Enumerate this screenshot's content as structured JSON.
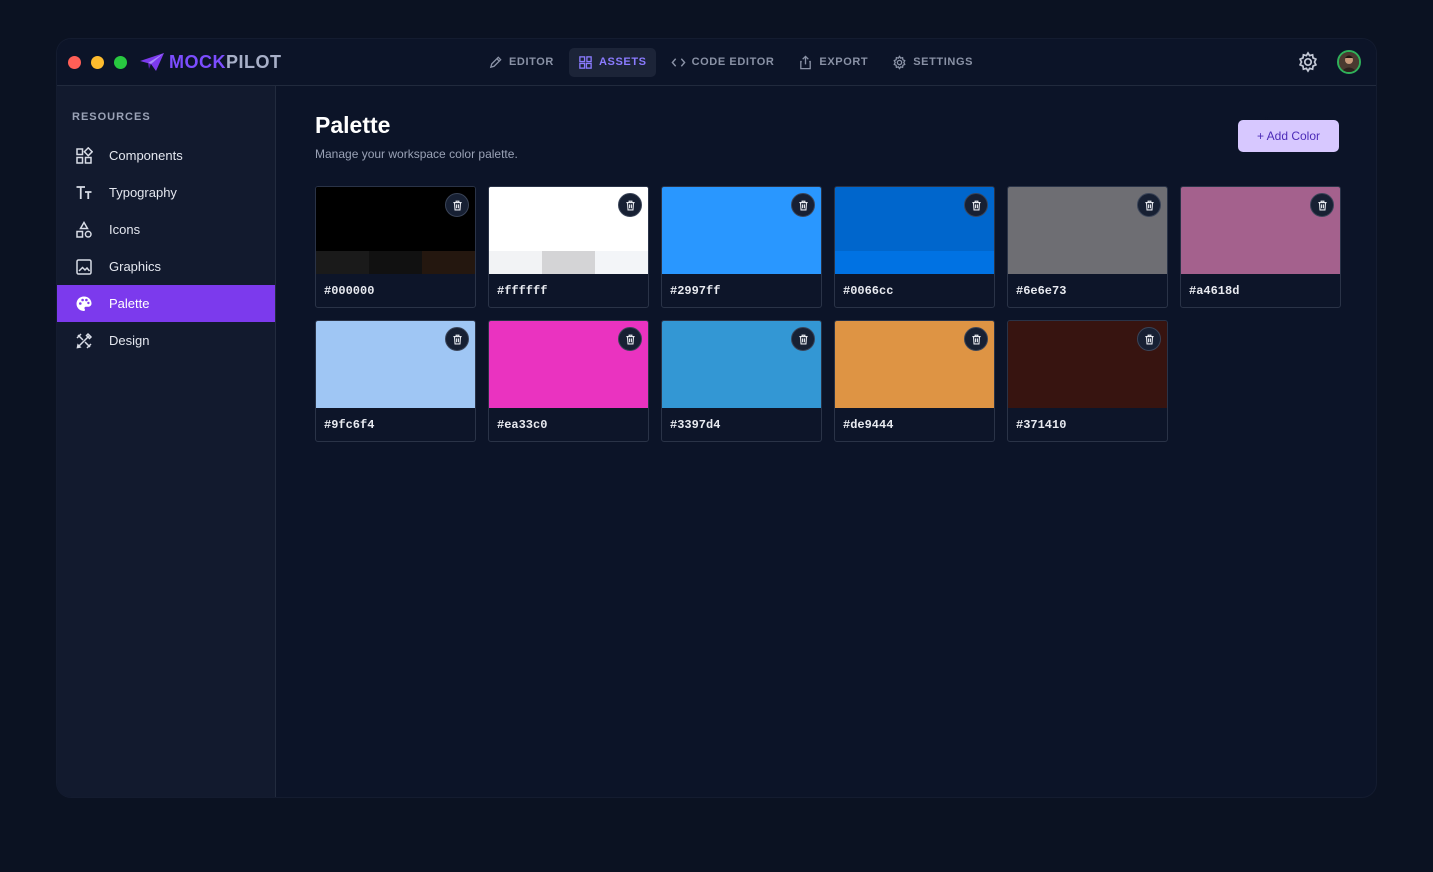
{
  "app": {
    "brand_part1": "MOCK",
    "brand_part2": "PILOT",
    "brand_icon": "paper-plane-icon",
    "accent": "#7c3aed"
  },
  "topnav": [
    {
      "label": "EDITOR",
      "icon": "pencil-icon",
      "active": false
    },
    {
      "label": "ASSETS",
      "icon": "grid-icon",
      "active": true
    },
    {
      "label": "CODE EDITOR",
      "icon": "code-icon",
      "active": false
    },
    {
      "label": "EXPORT",
      "icon": "share-icon",
      "active": false
    },
    {
      "label": "SETTINGS",
      "icon": "gear-icon",
      "active": false
    }
  ],
  "sidebar": {
    "heading": "RESOURCES",
    "items": [
      {
        "label": "Components",
        "icon": "components-icon"
      },
      {
        "label": "Typography",
        "icon": "typography-icon"
      },
      {
        "label": "Icons",
        "icon": "shapes-icon"
      },
      {
        "label": "Graphics",
        "icon": "image-icon"
      },
      {
        "label": "Palette",
        "icon": "palette-icon",
        "active": true
      },
      {
        "label": "Design",
        "icon": "design-tools-icon"
      }
    ]
  },
  "main": {
    "title": "Palette",
    "subtitle": "Manage your workspace color palette.",
    "add_button": "+ Add Color"
  },
  "colors": [
    {
      "hex": "#000000",
      "swatch": "#000000",
      "shades": [
        "#1a1a1a",
        "#111111",
        "#24170f"
      ]
    },
    {
      "hex": "#ffffff",
      "swatch": "#ffffff",
      "shades": [
        "#f2f3f5",
        "#d4d4d6",
        "#f3f5f8"
      ]
    },
    {
      "hex": "#2997ff",
      "swatch": "#2997ff",
      "shades": []
    },
    {
      "hex": "#0066cc",
      "swatch": "#0066cc",
      "shades": [
        "#0072e3"
      ]
    },
    {
      "hex": "#6e6e73",
      "swatch": "#6e6e73",
      "shades": []
    },
    {
      "hex": "#a4618d",
      "swatch": "#a4618d",
      "shades": []
    },
    {
      "hex": "#9fc6f4",
      "swatch": "#9fc6f4",
      "shades": []
    },
    {
      "hex": "#ea33c0",
      "swatch": "#ea33c0",
      "shades": []
    },
    {
      "hex": "#3397d4",
      "swatch": "#3397d4",
      "shades": []
    },
    {
      "hex": "#de9444",
      "swatch": "#de9444",
      "shades": []
    },
    {
      "hex": "#371410",
      "swatch": "#371410",
      "shades": []
    }
  ]
}
